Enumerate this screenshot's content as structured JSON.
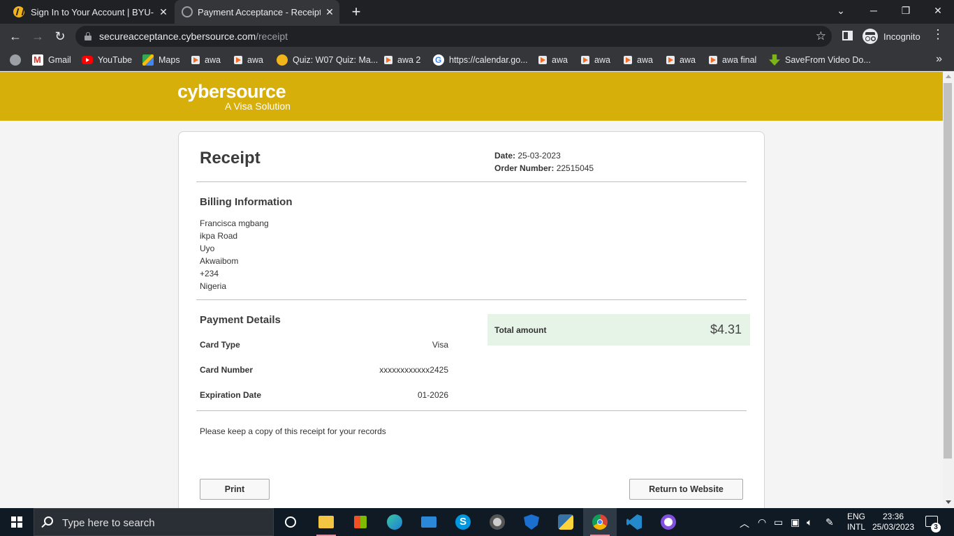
{
  "browser": {
    "tabs": [
      {
        "title": "Sign In to Your Account | BYU-Pat",
        "favicon": "byu-pathway-icon"
      },
      {
        "title": "Payment Acceptance - Receipt",
        "favicon": "globe-icon"
      }
    ],
    "address": {
      "domain": "secureacceptance.cybersource.com",
      "path": "/receipt"
    },
    "profile_label": "Incognito",
    "bookmarks": [
      {
        "label": "Gmail",
        "icon": "gmail-icon"
      },
      {
        "label": "YouTube",
        "icon": "youtube-icon"
      },
      {
        "label": "Maps",
        "icon": "maps-icon"
      },
      {
        "label": "awa",
        "icon": "awa-icon"
      },
      {
        "label": "awa",
        "icon": "awa-icon"
      },
      {
        "label": "Quiz: W07 Quiz: Ma...",
        "icon": "byu-pathway-icon"
      },
      {
        "label": "awa 2",
        "icon": "awa-icon"
      },
      {
        "label": "https://calendar.go...",
        "icon": "google-icon"
      },
      {
        "label": "awa",
        "icon": "awa-icon"
      },
      {
        "label": "awa",
        "icon": "awa-icon"
      },
      {
        "label": "awa",
        "icon": "awa-icon"
      },
      {
        "label": "awa",
        "icon": "awa-icon"
      },
      {
        "label": "awa final",
        "icon": "awa-icon"
      },
      {
        "label": "SaveFrom Video Do...",
        "icon": "savefrom-icon"
      }
    ]
  },
  "brand": {
    "name": "cybersource",
    "tagline": "A Visa Solution",
    "color": "#d6af0b"
  },
  "receipt": {
    "title": "Receipt",
    "date_label": "Date:",
    "date": "25-03-2023",
    "order_label": "Order Number:",
    "order_number": "22515045",
    "billing": {
      "heading": "Billing Information",
      "lines": [
        "Francisca mgbang",
        "ikpa Road",
        "Uyo",
        "Akwaibom",
        "+234",
        "Nigeria"
      ]
    },
    "payment": {
      "heading": "Payment Details",
      "rows": [
        {
          "label": "Card Type",
          "value": "Visa"
        },
        {
          "label": "Card Number",
          "value": "xxxxxxxxxxxx2425"
        },
        {
          "label": "Expiration Date",
          "value": "01-2026"
        }
      ]
    },
    "total": {
      "label": "Total amount",
      "value": "$4.31"
    },
    "note": "Please keep a copy of this receipt for your records",
    "print_label": "Print",
    "return_label": "Return to Website"
  },
  "taskbar": {
    "search_placeholder": "Type here to search",
    "apps": [
      "task-view-icon",
      "file-explorer-icon",
      "microsoft-store-icon",
      "edge-icon",
      "mail-icon",
      "skype-icon",
      "media-player-icon",
      "defender-icon",
      "python-icon",
      "chrome-icon",
      "vscode-icon",
      "github-desktop-icon"
    ],
    "lang_line1": "ENG",
    "lang_line2": "INTL",
    "time": "23:36",
    "date": "25/03/2023",
    "notification_count": "3"
  }
}
